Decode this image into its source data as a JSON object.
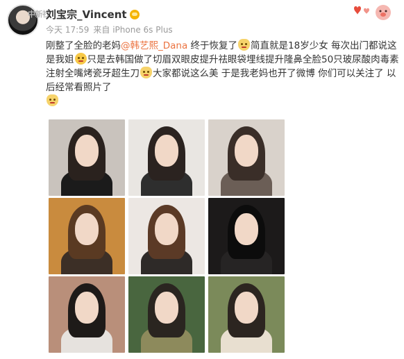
{
  "header": {
    "username": "刘宝宗_Vincent",
    "watermark": "中新社",
    "time": "今天 17:59",
    "source": "来自 iPhone 6s Plus"
  },
  "post": {
    "text_1": "刚整了全脸的老妈",
    "mention": "@韩艺熙_Dana",
    "text_2": "  终于恢复了",
    "text_3": "简直就是18岁少女 每次出门都说这是我姐",
    "text_4": "只是去韩国做了切眉双眼皮提升祛眼袋埋线提升隆鼻全脸50只玻尿酸肉毒素注射全嘴烤瓷牙超生刀",
    "text_5": "大家都说这么美 于是我老妈也开了微博 你们可以关注了 以后经常看照片了"
  },
  "icons": {
    "avatar": "avatar",
    "verified": "verified-badge-icon",
    "emoji_cat": "cat-emoji-icon",
    "emoji_smile": "smile-emoji-icon",
    "decoration": "hearts-piggy-decoration"
  },
  "photos": [
    {
      "bg": "#c9c3bd",
      "hair": "#2a221e",
      "body": "#1b1b1b"
    },
    {
      "bg": "#e9e6e2",
      "hair": "#2b2320",
      "body": "#2e2e2e"
    },
    {
      "bg": "#d9d2cb",
      "hair": "#3a2e28",
      "body": "#6b5e56"
    },
    {
      "bg": "#c98b3e",
      "hair": "#5a3a22",
      "body": "#3c2f26"
    },
    {
      "bg": "#ece7e3",
      "hair": "#5b3a26",
      "body": "#2e2a28"
    },
    {
      "bg": "#1c1a1a",
      "hair": "#0c0c0c",
      "body": "#262424"
    },
    {
      "bg": "#b98f7a",
      "hair": "#1e1a18",
      "body": "#e6e2de"
    },
    {
      "bg": "#49663f",
      "hair": "#2a2520",
      "body": "#8d8a5c"
    },
    {
      "bg": "#7b8a5a",
      "hair": "#2c2520",
      "body": "#e8dfd0"
    }
  ]
}
